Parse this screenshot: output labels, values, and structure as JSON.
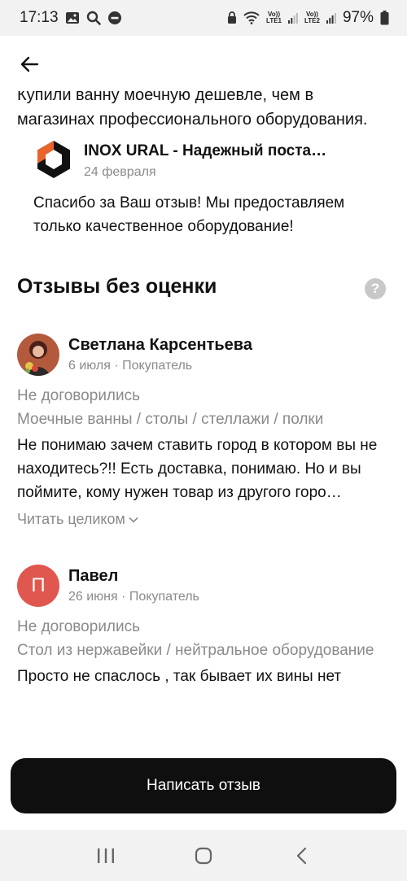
{
  "status_bar": {
    "time": "17:13",
    "battery_pct": "97%",
    "lte1": "LTE1",
    "lte2": "LTE2",
    "volte": "Vo))"
  },
  "header": {
    "back_icon": "arrow-left-icon"
  },
  "previous_review": {
    "clipped_line": "Купили ванну моечную дешевле, чем в",
    "line2": "магазинах профессионального оборудования."
  },
  "reply": {
    "company_name": "INOX URAL - Надежный поста…",
    "date": "24 февраля",
    "text": "Спасибо за Ваш отзыв! Мы предоставляем только качественное оборудование!",
    "logo_color": "#e8642c"
  },
  "section": {
    "title": "Отзывы без оценки",
    "help_symbol": "?"
  },
  "reviews": [
    {
      "author": "Светлана Карсентьева",
      "date": "6 июля",
      "separator": " · ",
      "role": "Покупатель",
      "status": "Не договорились",
      "category": "Моечные ванны / столы / стеллажи / полки",
      "text": "Не понимаю зачем ставить город в котором вы не находитесь?!! Есть доставка, понимаю. Но и вы поймите, кому нужен товар из другого горо…",
      "read_more": "Читать целиком"
    },
    {
      "author": "Павел",
      "avatar_letter": "П",
      "avatar_color": "#e0574f",
      "date": "26 июня",
      "separator": " · ",
      "role": "Покупатель",
      "status": "Не договорились",
      "category": "Стол из нержавейки / нейтральное оборудование",
      "text": "Просто не спаслось , так бывает их вины нет"
    }
  ],
  "actions": {
    "write_review": "Написать отзыв"
  },
  "nav": {
    "recent": "recent-apps-icon",
    "home": "home-icon",
    "back": "back-icon"
  }
}
